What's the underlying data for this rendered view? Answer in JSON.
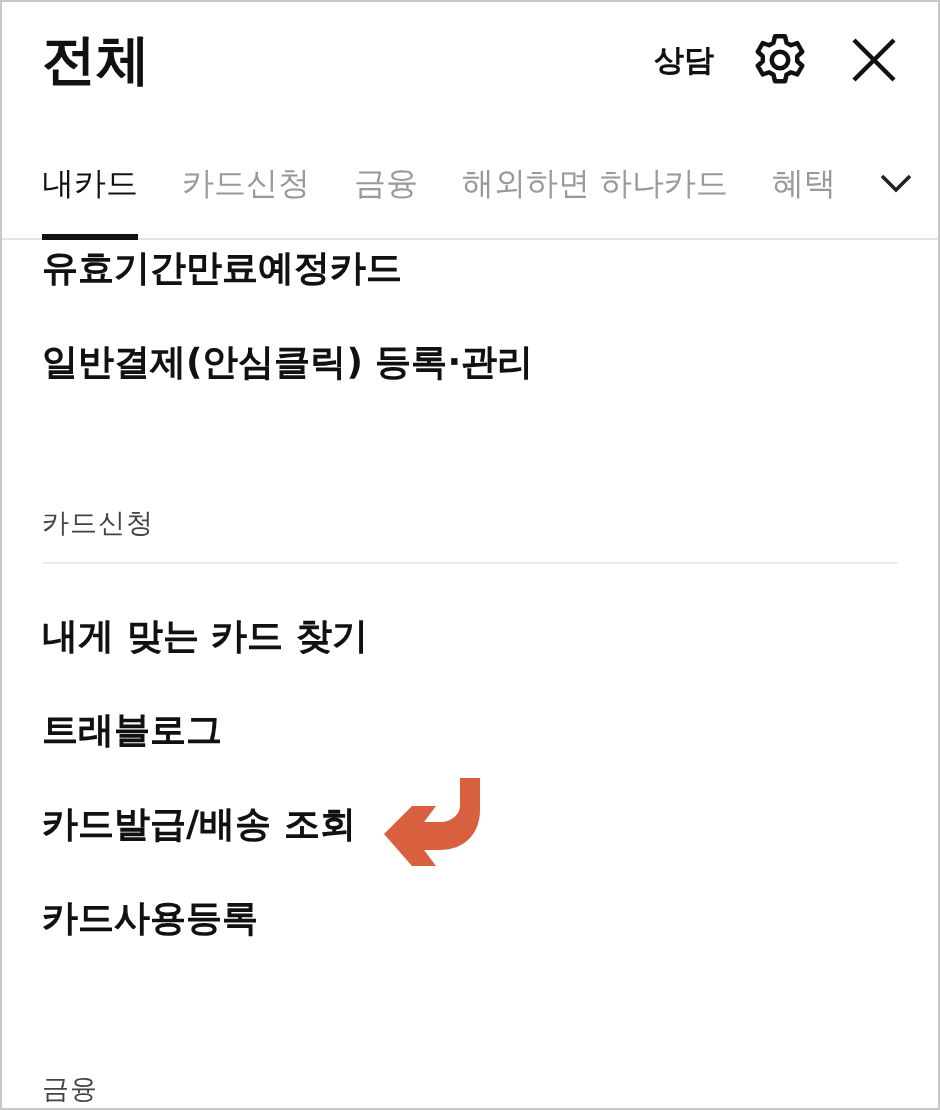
{
  "header": {
    "title": "전체",
    "consult": "상담"
  },
  "tabs": [
    {
      "label": "내카드",
      "selected": true
    },
    {
      "label": "카드신청",
      "selected": false
    },
    {
      "label": "금융",
      "selected": false
    },
    {
      "label": "해외하면 하나카드",
      "selected": false
    },
    {
      "label": "혜택",
      "selected": false
    }
  ],
  "sections": [
    {
      "items": [
        "유효기간만료예정카드",
        "일반결제(안심클릭) 등록·관리"
      ]
    },
    {
      "heading": "카드신청",
      "items": [
        "내게 맞는 카드 찾기",
        "트래블로그",
        {
          "label": "카드발급/배송 조회",
          "pointer_arrow": true
        },
        "카드사용등록"
      ]
    },
    {
      "heading": "금융"
    }
  ]
}
